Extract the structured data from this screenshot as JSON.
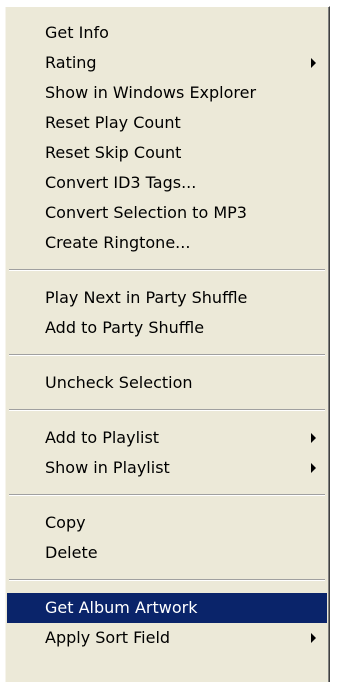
{
  "menu": {
    "items": [
      {
        "label": "Get Info",
        "has_submenu": false
      },
      {
        "label": "Rating",
        "has_submenu": true
      },
      {
        "label": "Show in Windows Explorer",
        "has_submenu": false
      },
      {
        "label": "Reset Play Count",
        "has_submenu": false
      },
      {
        "label": "Reset Skip Count",
        "has_submenu": false
      },
      {
        "label": "Convert ID3 Tags...",
        "has_submenu": false
      },
      {
        "label": "Convert Selection to MP3",
        "has_submenu": false
      },
      {
        "label": "Create Ringtone...",
        "has_submenu": false
      },
      {
        "label": "Play Next in Party Shuffle",
        "has_submenu": false
      },
      {
        "label": "Add to Party Shuffle",
        "has_submenu": false
      },
      {
        "label": "Uncheck Selection",
        "has_submenu": false
      },
      {
        "label": "Add to Playlist",
        "has_submenu": true
      },
      {
        "label": "Show in Playlist",
        "has_submenu": true
      },
      {
        "label": "Copy",
        "has_submenu": false
      },
      {
        "label": "Delete",
        "has_submenu": false
      },
      {
        "label": "Get Album Artwork",
        "has_submenu": false,
        "highlighted": true
      },
      {
        "label": "Apply Sort Field",
        "has_submenu": true
      }
    ]
  },
  "colors": {
    "menu_background": "#ece9d8",
    "highlight_background": "#0a246a",
    "highlight_text": "#ffffff",
    "text": "#000000"
  }
}
